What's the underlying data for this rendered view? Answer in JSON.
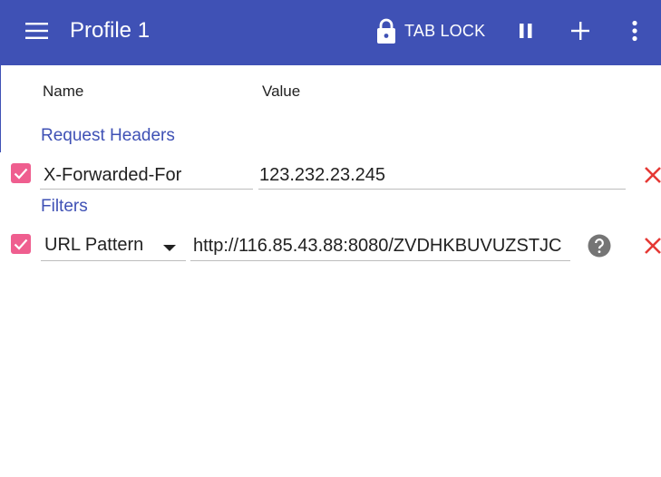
{
  "toolbar": {
    "title": "Profile 1",
    "tab_lock_label": "TAB LOCK",
    "background_color": "#3f51b5",
    "icons": [
      "menu-icon",
      "lock-icon",
      "pause-icon",
      "add-icon",
      "more-vert-icon"
    ]
  },
  "columns": {
    "name": "Name",
    "value": "Value"
  },
  "sections": {
    "request_headers": {
      "title": "Request Headers",
      "items": [
        {
          "enabled": true,
          "name": "X-Forwarded-For",
          "value": "123.232.23.245"
        }
      ]
    },
    "filters": {
      "title": "Filters",
      "items": [
        {
          "enabled": true,
          "type": "URL Pattern",
          "value": "http://116.85.43.88:8080/ZVDHKBUVUZSTJC"
        }
      ]
    }
  },
  "colors": {
    "accent": "#3f51b5",
    "checkbox": "#ef5e8f",
    "delete": "#e53935",
    "help": "#757575"
  }
}
